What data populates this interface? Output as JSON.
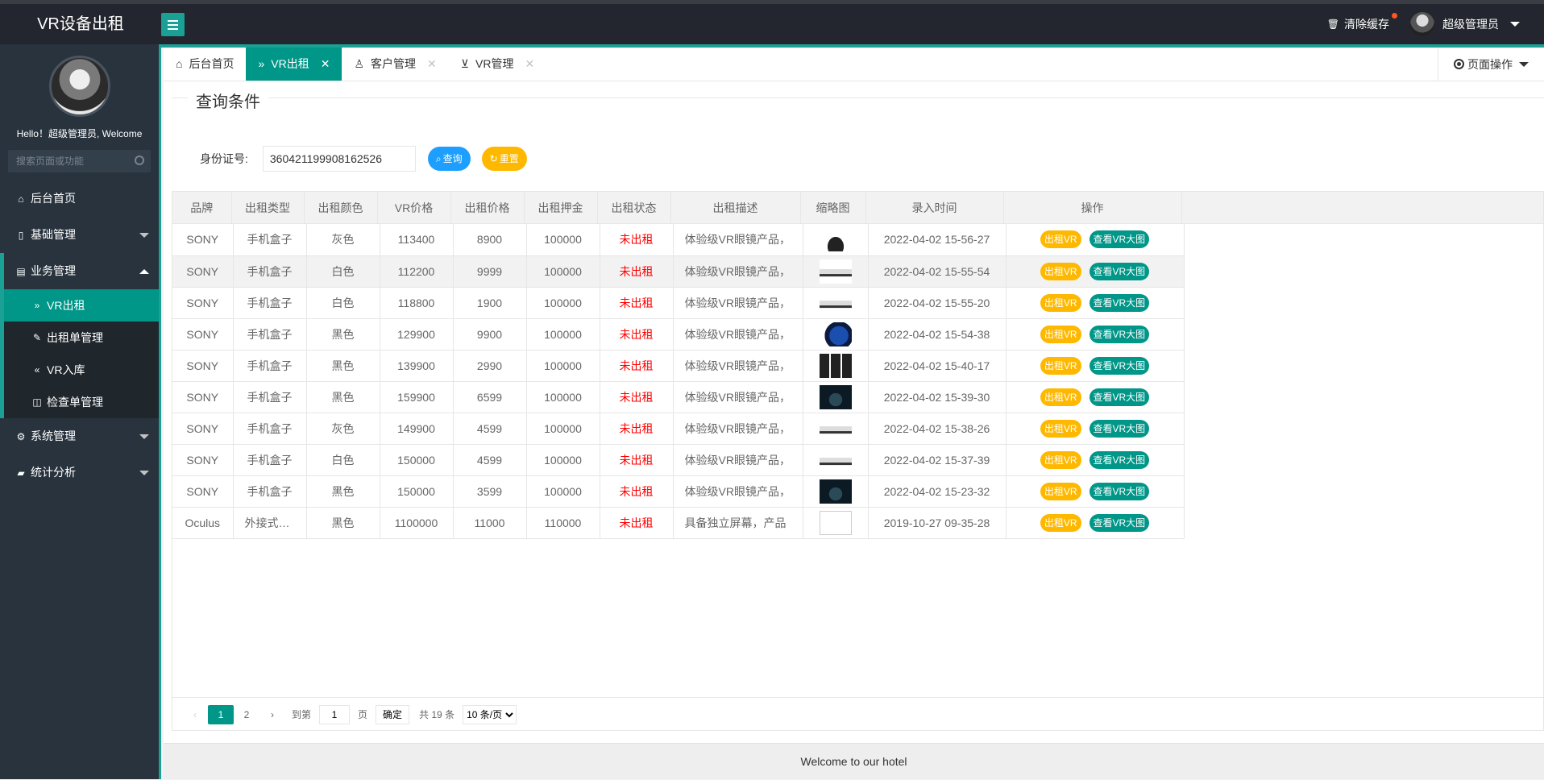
{
  "app": {
    "title": "VR设备出租"
  },
  "header": {
    "clear_cache": "清除缓存",
    "user_name": "超级管理员"
  },
  "sidebar": {
    "hello": "Hello！超级管理员, Welcome",
    "search_placeholder": "搜索页面或功能",
    "items": [
      {
        "label": "后台首页",
        "icon": "home-icon"
      },
      {
        "label": "基础管理",
        "icon": "file-icon"
      },
      {
        "label": "业务管理",
        "icon": "book-icon"
      },
      {
        "label": "系统管理",
        "icon": "gear-icon"
      },
      {
        "label": "统计分析",
        "icon": "chart-icon"
      }
    ],
    "sub_items": [
      {
        "label": "VR出租"
      },
      {
        "label": "出租单管理"
      },
      {
        "label": "VR入库"
      },
      {
        "label": "检查单管理"
      }
    ]
  },
  "tabs": [
    {
      "label": "后台首页"
    },
    {
      "label": "VR出租"
    },
    {
      "label": "客户管理"
    },
    {
      "label": "VR管理"
    }
  ],
  "page_ops": "页面操作",
  "query": {
    "legend": "查询条件",
    "id_label": "身份证号:",
    "id_value": "360421199908162526",
    "search_btn": "查询",
    "reset_btn": "重置"
  },
  "table": {
    "columns": [
      "品牌",
      "出租类型",
      "出租颜色",
      "VR价格",
      "出租价格",
      "出租押金",
      "出租状态",
      "出租描述",
      "缩略图",
      "录入时间",
      "操作"
    ],
    "rows": [
      {
        "brand": "SONY",
        "type": "手机盒子",
        "color": "灰色",
        "price": "113400",
        "rent": "8900",
        "deposit": "100000",
        "status": "未出租",
        "desc": "体验级VR眼镜产品，",
        "time": "2022-04-02 15-56-27"
      },
      {
        "brand": "SONY",
        "type": "手机盒子",
        "color": "白色",
        "price": "112200",
        "rent": "9999",
        "deposit": "100000",
        "status": "未出租",
        "desc": "体验级VR眼镜产品，",
        "time": "2022-04-02 15-55-54"
      },
      {
        "brand": "SONY",
        "type": "手机盒子",
        "color": "白色",
        "price": "118800",
        "rent": "1900",
        "deposit": "100000",
        "status": "未出租",
        "desc": "体验级VR眼镜产品，",
        "time": "2022-04-02 15-55-20"
      },
      {
        "brand": "SONY",
        "type": "手机盒子",
        "color": "黑色",
        "price": "129900",
        "rent": "9900",
        "deposit": "100000",
        "status": "未出租",
        "desc": "体验级VR眼镜产品，",
        "time": "2022-04-02 15-54-38"
      },
      {
        "brand": "SONY",
        "type": "手机盒子",
        "color": "黑色",
        "price": "139900",
        "rent": "2990",
        "deposit": "100000",
        "status": "未出租",
        "desc": "体验级VR眼镜产品，",
        "time": "2022-04-02 15-40-17"
      },
      {
        "brand": "SONY",
        "type": "手机盒子",
        "color": "黑色",
        "price": "159900",
        "rent": "6599",
        "deposit": "100000",
        "status": "未出租",
        "desc": "体验级VR眼镜产品，",
        "time": "2022-04-02 15-39-30"
      },
      {
        "brand": "SONY",
        "type": "手机盒子",
        "color": "灰色",
        "price": "149900",
        "rent": "4599",
        "deposit": "100000",
        "status": "未出租",
        "desc": "体验级VR眼镜产品，",
        "time": "2022-04-02 15-38-26"
      },
      {
        "brand": "SONY",
        "type": "手机盒子",
        "color": "白色",
        "price": "150000",
        "rent": "4599",
        "deposit": "100000",
        "status": "未出租",
        "desc": "体验级VR眼镜产品，",
        "time": "2022-04-02 15-37-39"
      },
      {
        "brand": "SONY",
        "type": "手机盒子",
        "color": "黑色",
        "price": "150000",
        "rent": "3599",
        "deposit": "100000",
        "status": "未出租",
        "desc": "体验级VR眼镜产品，",
        "time": "2022-04-02 15-23-32"
      },
      {
        "brand": "Oculus",
        "type": "外接式头显",
        "color": "黑色",
        "price": "1100000",
        "rent": "11000",
        "deposit": "110000",
        "status": "未出租",
        "desc": "具备独立屏幕，产品",
        "time": "2019-10-27 09-35-28"
      }
    ],
    "op_rent": "出租VR",
    "op_view": "查看VR大图"
  },
  "pager": {
    "pages": [
      "1",
      "2"
    ],
    "goto_label": "到第",
    "goto_value": "1",
    "page_unit": "页",
    "confirm": "确定",
    "total": "共 19 条",
    "per_page": "10 条/页"
  },
  "footer": "Welcome to our hotel"
}
